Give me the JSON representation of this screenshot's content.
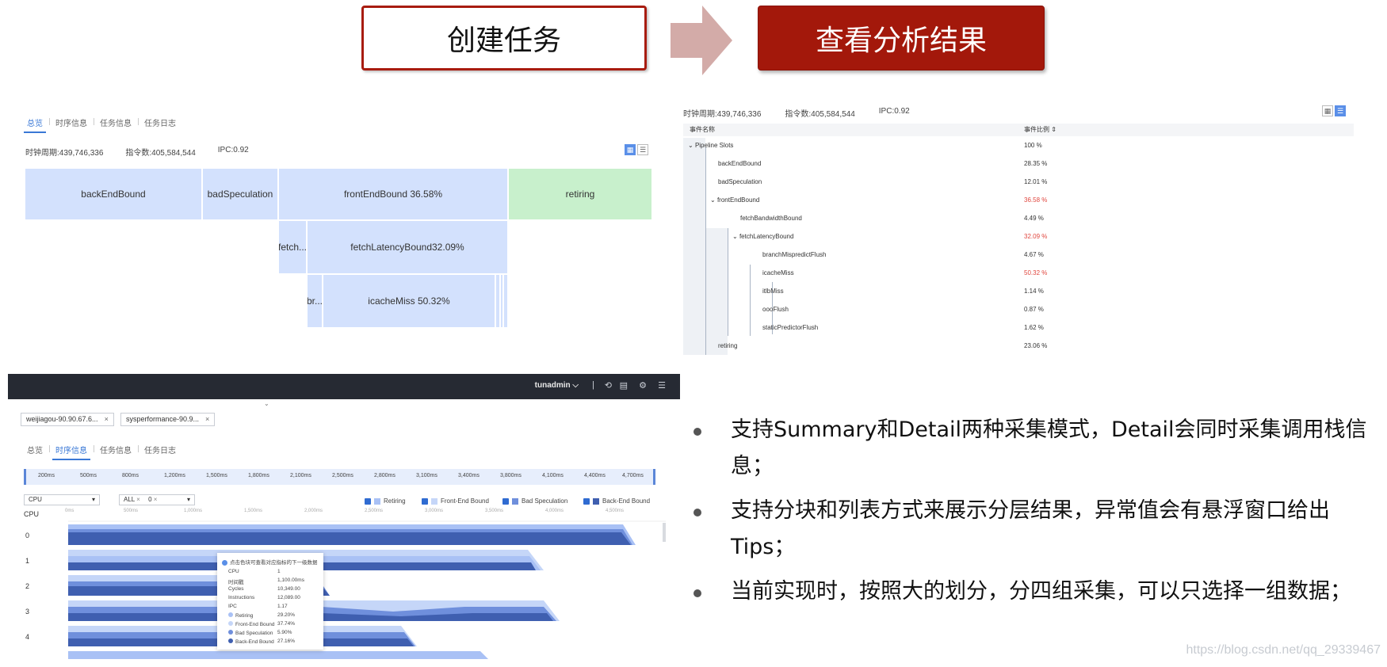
{
  "flow": {
    "step1": "创建任务",
    "step2": "查看分析结果"
  },
  "block_view": {
    "tabs": [
      "总览",
      "时序信息",
      "任务信息",
      "任务日志"
    ],
    "metrics": {
      "cycles": "时钟周期:439,746,336",
      "instructions": "指令数:405,584,544",
      "ipc": "IPC:0.92"
    },
    "blocks": {
      "backend": "backEndBound",
      "badspec": "badSpeculation",
      "frontend": "frontEndBound 36.58%",
      "retiring": "retiring",
      "fetch_short": "fetch...",
      "fetch_latency": "fetchLatencyBound32.09%",
      "br_short": "br...",
      "icache": "icacheMiss 50.32%"
    }
  },
  "list_view": {
    "metrics": {
      "cycles": "时钟周期:439,746,336",
      "instructions": "指令数:405,584,544",
      "ipc": "IPC:0.92"
    },
    "col_event": "事件名称",
    "col_ratio": "事件比例 ⇕",
    "rows": [
      {
        "name": "Pipeline Slots",
        "value": "100 %"
      },
      {
        "name": "backEndBound",
        "value": "28.35 %"
      },
      {
        "name": "badSpeculation",
        "value": "12.01 %"
      },
      {
        "name": "frontEndBound",
        "value": "36.58 %"
      },
      {
        "name": "fetchBandwidthBound",
        "value": "4.49 %"
      },
      {
        "name": "fetchLatencyBound",
        "value": "32.09 %"
      },
      {
        "name": "branchMispredictFlush",
        "value": "4.67 %"
      },
      {
        "name": "icacheMiss",
        "value": "50.32 %"
      },
      {
        "name": "itlbMiss",
        "value": "1.14 %"
      },
      {
        "name": "oooFlush",
        "value": "0.87 %"
      },
      {
        "name": "staticPredictorFlush",
        "value": "1.62 %"
      },
      {
        "name": "retiring",
        "value": "23.06 %"
      }
    ]
  },
  "timeline": {
    "user": "tunadmin ⌵",
    "chips": [
      "weijiagou-90.90.67.6...",
      "sysperformance-90.9..."
    ],
    "tabs": [
      "总览",
      "时序信息",
      "任务信息",
      "任务日志"
    ],
    "ruler_ticks": [
      "200ms",
      "500ms",
      "800ms",
      "1,200ms",
      "1,500ms",
      "1,800ms",
      "2,100ms",
      "2,500ms",
      "2,800ms",
      "3,100ms",
      "3,400ms",
      "3,800ms",
      "4,100ms",
      "4,400ms",
      "4,700ms"
    ],
    "cpu_select": "CPU",
    "filter_all": "ALL",
    "filter_zero": "0",
    "legend": [
      "Retiring",
      "Front-End Bound",
      "Bad Speculation",
      "Back-End Bound"
    ],
    "axis_label": "CPU",
    "cpus": [
      "0",
      "1",
      "2",
      "3",
      "4"
    ],
    "x_ticks": [
      "0ms",
      "500ms",
      "1,000ms",
      "1,500ms",
      "2,000ms",
      "2,500ms",
      "3,000ms",
      "3,500ms",
      "4,000ms",
      "4,500ms"
    ],
    "tooltip": {
      "title": "点击色块可查看对应指标的下一级数据",
      "rows": [
        {
          "k": "CPU",
          "v": "1"
        },
        {
          "k": "时间戳",
          "v": "1,100.00ms"
        },
        {
          "k": "Cycles",
          "v": "10,349.00"
        },
        {
          "k": "Instructions",
          "v": "12,089.00"
        },
        {
          "k": "IPC",
          "v": "1.17"
        },
        {
          "k": "Retiring",
          "v": "29.20%"
        },
        {
          "k": "Front-End Bound",
          "v": "37.74%"
        },
        {
          "k": "Bad Speculation",
          "v": "5.90%"
        },
        {
          "k": "Back-End Bound",
          "v": "27.16%"
        }
      ]
    },
    "colors": {
      "retiring": "#a9c1f5",
      "frontend": "#c5d6f8",
      "badspec": "#6f8fdc",
      "backend": "#3f5fb0"
    }
  },
  "bullets": [
    "支持Summary和Detail两种采集模式，Detail会同时采集调用栈信息；",
    "支持分块和列表方式来展示分层结果，异常值会有悬浮窗口给出Tips；",
    "当前实现时，按照大的划分，分四组采集，可以只选择一组数据；"
  ],
  "watermark": "https://blog.csdn.net/qq_29339467"
}
